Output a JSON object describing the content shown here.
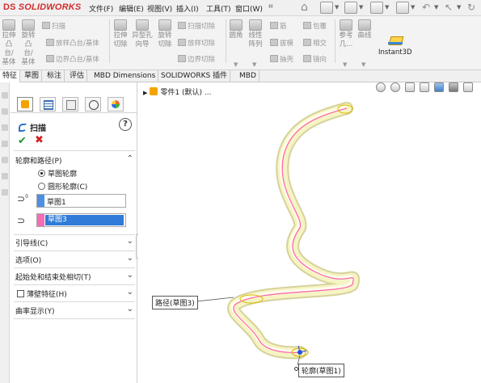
{
  "app": {
    "logo_ds": "DS",
    "logo_text": "SOLIDWORKS"
  },
  "menu": {
    "items": [
      "文件(F)",
      "编辑(E)",
      "视图(V)",
      "插入(I)",
      "工具(T)",
      "窗口(W)"
    ]
  },
  "ribbon": {
    "big": [
      {
        "label1": "拉伸",
        "label2": "凸台/",
        "label3": "基体"
      },
      {
        "label1": "旋转",
        "label2": "凸台/",
        "label3": "基体"
      },
      {
        "label1": "拉伸",
        "label2": "切除"
      },
      {
        "label1": "异型孔",
        "label2": "向导"
      },
      {
        "label1": "旋转",
        "label2": "切除"
      },
      {
        "label1": "圆角"
      },
      {
        "label1": "线性",
        "label2": "阵列"
      },
      {
        "label1": "参考",
        "label2": "几..."
      },
      {
        "label1": "曲线"
      }
    ],
    "small": {
      "sweep": "扫描",
      "loft": "放样凸台/基体",
      "boundary": "边界凸台/基体",
      "sweep_cut": "扫描切除",
      "loft_cut": "放样切除",
      "boundary_cut": "边界切除",
      "rib": "筋",
      "draft": "拔模",
      "shell": "抽壳",
      "wrap": "包覆",
      "intersect": "相交",
      "mirror": "镜向"
    },
    "instant3d": "Instant3D"
  },
  "tabs": [
    "特征",
    "草图",
    "标注",
    "评估",
    "MBD Dimensions",
    "SOLIDWORKS 插件",
    "MBD"
  ],
  "pm": {
    "title": "扫描",
    "help": "?",
    "ok": "✔",
    "cancel": "✖",
    "profile_path": {
      "heading": "轮廓和路径(P)",
      "option_sketch": "草图轮廓",
      "option_circle": "圆形轮廓(C)",
      "profile_value": "草图1",
      "path_value": "草图3"
    },
    "groups": {
      "guides": "引导线(C)",
      "options": "选项(O)",
      "tangency": "起始处和结束处相切(T)",
      "thin": "薄壁特征(H)",
      "curvature": "曲率显示(Y)"
    }
  },
  "graphics": {
    "tree_item": "零件1 (默认) ...",
    "callout_path": "路径(草图3)",
    "callout_profile": "轮廓(草图1)"
  },
  "colors": {
    "profile_bar": "#4f8fe0",
    "path_bar": "#f26fb6",
    "tube": "#f4f2b0",
    "path_line": "#ff5fb4",
    "accent_red": "#d22e2e"
  }
}
